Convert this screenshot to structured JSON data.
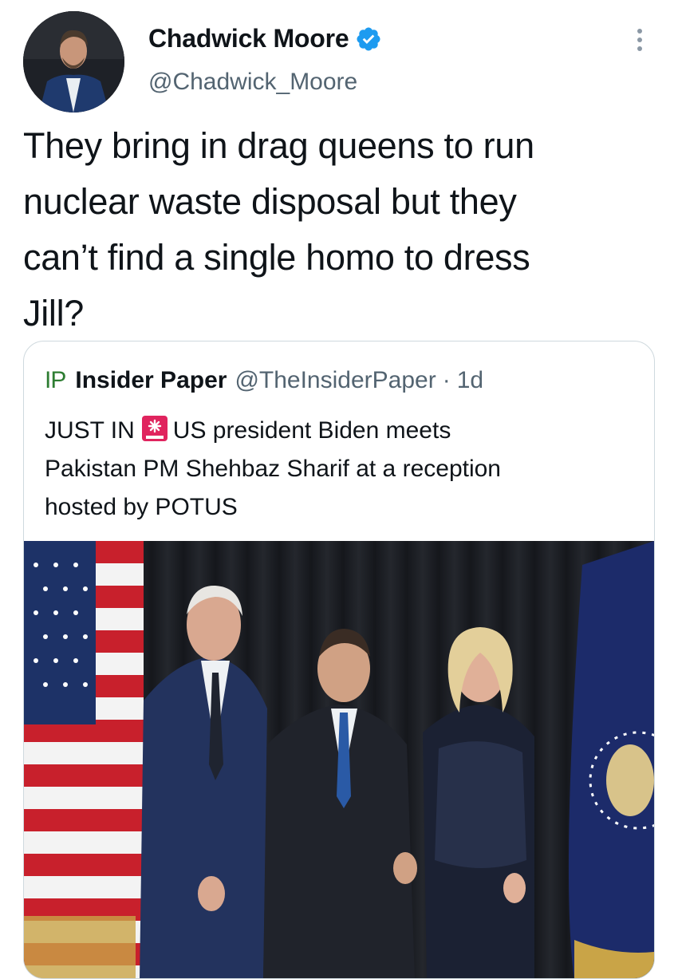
{
  "author": {
    "display_name": "Chadwick Moore",
    "handle": "@Chadwick_Moore",
    "verified": true
  },
  "tweet": {
    "lines": [
      "They bring in drag queens to run",
      "nuclear waste disposal but they",
      "can’t find a single homo to dress",
      "Jill?"
    ]
  },
  "quoted_tweet": {
    "logo_text": "IP",
    "name": "Insider Paper",
    "handle": "@TheInsiderPaper",
    "separator": "·",
    "time": "1d",
    "text_prefix": "JUST IN",
    "text_rest": "US president Biden meets",
    "lines": [
      "Pakistan PM Shehbaz Sharif at a reception",
      "hosted by POTUS"
    ],
    "media": "photo"
  },
  "colors": {
    "verified": "#1d9bf0",
    "secondary_text": "#536471",
    "border": "#cfd9de",
    "logo_green": "#2e7d32",
    "siren_red": "#e0245e"
  },
  "icons": [
    "verified-badge-icon",
    "more-options-icon",
    "siren-icon"
  ]
}
